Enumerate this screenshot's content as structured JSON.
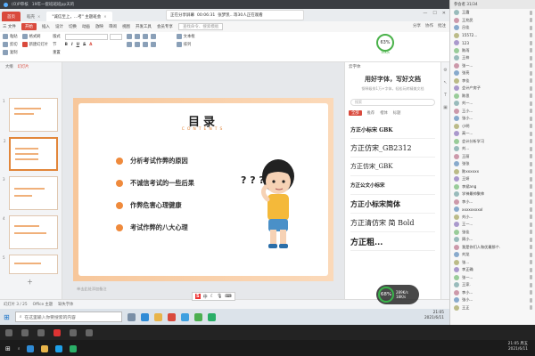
{
  "meeting": {
    "title": "(O)P审核",
    "tab_title": "19年一套班班班pp天的"
  },
  "wps": {
    "tabs": [
      {
        "label": "首页"
      },
      {
        "label": "稻壳"
      },
      {
        "label": "\"诚信至上，...考\" 主题班会"
      }
    ],
    "share_banner": {
      "text": "正在分享屏幕",
      "timer": "00:06:31",
      "who": "张梦凯...等30人正在观看"
    },
    "menu": [
      "三 文件",
      "开始",
      "插入",
      "设计",
      "切换",
      "动画",
      "放映",
      "审阅",
      "视图",
      "开发工具",
      "会员专享"
    ],
    "menu_search": "查找命令、搜索模板",
    "collab": [
      "分享",
      "协作",
      "批注"
    ],
    "ribbon": {
      "paste": "粘贴",
      "cut": "剪切",
      "copy": "复制",
      "format_painter": "格式刷",
      "new_slide": "新建幻灯片",
      "layout": "版式",
      "section": "节",
      "reset": "重置",
      "text_box": "文本框",
      "arrange": "排列"
    },
    "gauge": {
      "value": "63%",
      "sub": "18K/s"
    }
  },
  "thumbs": {
    "tabs": [
      "大纲",
      "幻灯片"
    ],
    "numbers": [
      "1",
      "2",
      "3",
      "4",
      "5"
    ]
  },
  "slide": {
    "title": "目录",
    "subtitle": "CONTENTS",
    "items": [
      "分析考试作弊的原因",
      "不诚信考试的一些后果",
      "作弊危害心理健康",
      "考试作弊的八大心理"
    ],
    "question_marks": "? ? ?"
  },
  "notes_placeholder": "单击此处添加备注",
  "font_panel": {
    "header": "云字体",
    "title": "用好字体，写好文档",
    "desc": "钢琴级排1万+字体，轻松玩转精美文档",
    "search": "搜索",
    "tabs": [
      "全部",
      "推荐",
      "楷体",
      "标题"
    ],
    "fonts": [
      "方正小标宋 GBK",
      "方正仿宋_GB2312",
      "方正仿宋_GBK",
      "方正公文小标宋",
      "方正小标宋简体",
      "方正清仿宋 简 Bold",
      "方正粗..."
    ]
  },
  "status": {
    "slide_pos": "幻灯片 3 / 25",
    "theme": "Office 主题",
    "missing_font": "缺失字体"
  },
  "ime": {
    "logo": "S",
    "lang": "中"
  },
  "net": {
    "value": "68%",
    "up": "289K/s",
    "down": "18K/s"
  },
  "taskbar": {
    "search": "在这里输入你要搜索的内容",
    "time": "21:05",
    "date": "2021/6/11"
  },
  "os_taskbar": {
    "time": "21:05 周五",
    "date": "2021/6/11"
  },
  "participants": {
    "header": "参会者 31/34",
    "people": [
      "王霞",
      "王兆民",
      "吕佳",
      "15572...",
      "123",
      "陈雨",
      "王梓",
      "张一...",
      "张亮",
      "李佳",
      "会计产房子",
      "陈思",
      "刘一...",
      "王小...",
      "张小...",
      "小明",
      "高一...",
      "会计分析学习",
      "刘...",
      "王丽",
      "张张",
      "陈xxxxxx",
      "王妍",
      "李斌ang",
      "学神最帅聚帅",
      "李小...",
      "xxxxxxxxxl",
      "刘小...",
      "王一...",
      "张佳",
      "周小...",
      "我是你们人和优最那个.",
      "刘龙",
      "张...",
      "李正确",
      "张一...",
      "王家.",
      "李小...",
      "张小...",
      "王正"
    ]
  }
}
